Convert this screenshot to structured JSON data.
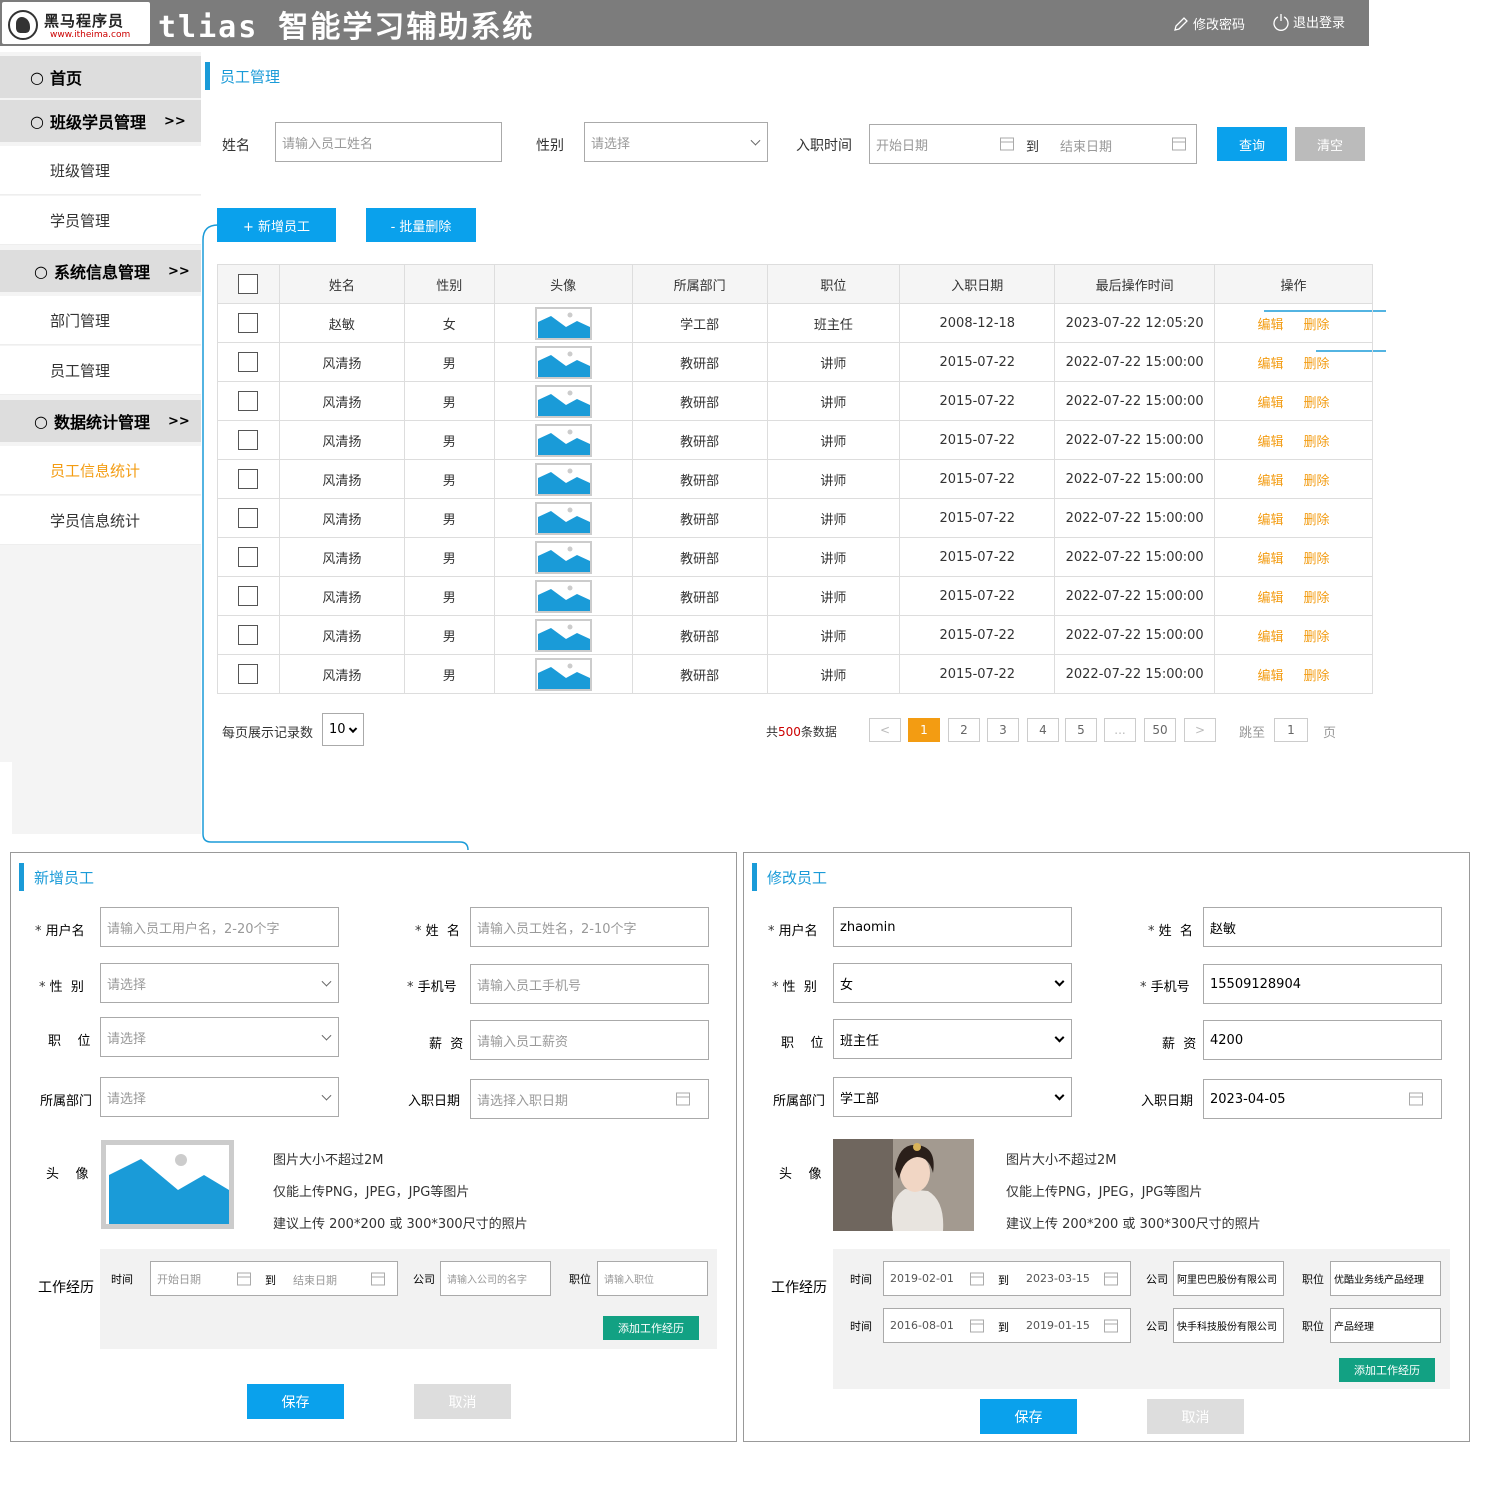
{
  "header": {
    "logo_text": "黑马程序员",
    "logo_sub": "www.itheima.com",
    "title": "tlias 智能学习辅助系统",
    "change_password": "修改密码",
    "logout": "退出登录"
  },
  "sidebar": {
    "home": "首页",
    "class_group": "班级学员管理",
    "class_mgmt": "班级管理",
    "student_mgmt": "学员管理",
    "sys_group": "系统信息管理",
    "dept_mgmt": "部门管理",
    "emp_mgmt": "员工管理",
    "stat_group": "数据统计管理",
    "emp_stat": "员工信息统计",
    "student_stat": "学员信息统计",
    "arrow": ">>"
  },
  "main": {
    "title": "员工管理",
    "search": {
      "name_label": "姓名",
      "name_placeholder": "请输入员工姓名",
      "gender_label": "性别",
      "gender_placeholder": "请选择",
      "date_label": "入职时间",
      "start_placeholder": "开始日期",
      "to": "到",
      "end_placeholder": "结束日期",
      "query": "查询",
      "clear": "清空"
    },
    "add_button": "+ 新增员工",
    "batch_delete": "- 批量删除",
    "columns": [
      "姓名",
      "性别",
      "头像",
      "所属部门",
      "职位",
      "入职日期",
      "最后操作时间",
      "操作"
    ],
    "edit": "编辑",
    "delete": "删除",
    "rows": [
      {
        "name": "赵敏",
        "gender": "女",
        "dept": "学工部",
        "job": "班主任",
        "entry": "2008-12-18",
        "updated": "2023-07-22 12:05:20"
      },
      {
        "name": "风清扬",
        "gender": "男",
        "dept": "教研部",
        "job": "讲师",
        "entry": "2015-07-22",
        "updated": "2022-07-22 15:00:00"
      },
      {
        "name": "风清扬",
        "gender": "男",
        "dept": "教研部",
        "job": "讲师",
        "entry": "2015-07-22",
        "updated": "2022-07-22 15:00:00"
      },
      {
        "name": "风清扬",
        "gender": "男",
        "dept": "教研部",
        "job": "讲师",
        "entry": "2015-07-22",
        "updated": "2022-07-22 15:00:00"
      },
      {
        "name": "风清扬",
        "gender": "男",
        "dept": "教研部",
        "job": "讲师",
        "entry": "2015-07-22",
        "updated": "2022-07-22 15:00:00"
      },
      {
        "name": "风清扬",
        "gender": "男",
        "dept": "教研部",
        "job": "讲师",
        "entry": "2015-07-22",
        "updated": "2022-07-22 15:00:00"
      },
      {
        "name": "风清扬",
        "gender": "男",
        "dept": "教研部",
        "job": "讲师",
        "entry": "2015-07-22",
        "updated": "2022-07-22 15:00:00"
      },
      {
        "name": "风清扬",
        "gender": "男",
        "dept": "教研部",
        "job": "讲师",
        "entry": "2015-07-22",
        "updated": "2022-07-22 15:00:00"
      },
      {
        "name": "风清扬",
        "gender": "男",
        "dept": "教研部",
        "job": "讲师",
        "entry": "2015-07-22",
        "updated": "2022-07-22 15:00:00"
      },
      {
        "name": "风清扬",
        "gender": "男",
        "dept": "教研部",
        "job": "讲师",
        "entry": "2015-07-22",
        "updated": "2022-07-22 15:00:00"
      }
    ],
    "page_size_label": "每页展示记录数",
    "page_size": "10",
    "total_prefix": "共",
    "total_count": "500",
    "total_suffix": "条数据",
    "pages": [
      "<",
      "1",
      "2",
      "3",
      "4",
      "5",
      "...",
      "50",
      ">"
    ],
    "current_page": "1",
    "jump_label": "跳至",
    "jump_value": "1",
    "page_unit": "页"
  },
  "add_dialog": {
    "title": "新增员工",
    "username_label": "用户名",
    "username_placeholder": "请输入员工用户名，2-20个字",
    "name_label": "姓  名",
    "name_placeholder": "请输入员工姓名，2-10个字",
    "gender_label": "性  别",
    "gender_placeholder": "请选择",
    "phone_label": "手机号",
    "phone_placeholder": "请输入员工手机号",
    "job_label": "职    位",
    "job_placeholder": "请选择",
    "salary_label": "薪  资",
    "salary_placeholder": "请输入员工薪资",
    "dept_label": "所属部门",
    "dept_placeholder": "请选择",
    "entry_label": "入职日期",
    "entry_placeholder": "请选择入职日期",
    "avatar_label": "头    像",
    "tip1": "图片大小不超过2M",
    "tip2": "仅能上传PNG，JPEG，JPG等图片",
    "tip3": "建议上传 200*200 或 300*300尺寸的照片",
    "exp_label": "工作经历",
    "time_label": "时间",
    "exp_start": "开始日期",
    "to": "到",
    "exp_end": "结束日期",
    "company_label": "公司",
    "company_placeholder": "请输入公司的名字",
    "position_label": "职位",
    "position_placeholder": "请输入职位",
    "add_exp": "添加工作经历",
    "save": "保存",
    "cancel": "取消"
  },
  "edit_dialog": {
    "title": "修改员工",
    "username_label": "用户名",
    "username": "zhaomin",
    "name_label": "姓  名",
    "name": "赵敏",
    "gender_label": "性  别",
    "gender": "女",
    "phone_label": "手机号",
    "phone": "15509128904",
    "job_label": "职    位",
    "job": "班主任",
    "salary_label": "薪  资",
    "salary": "4200",
    "dept_label": "所属部门",
    "dept": "学工部",
    "entry_label": "入职日期",
    "entry": "2023-04-05",
    "avatar_label": "头    像",
    "tip1": "图片大小不超过2M",
    "tip2": "仅能上传PNG，JPEG，JPG等图片",
    "tip3": "建议上传 200*200 或 300*300尺寸的照片",
    "exp_label": "工作经历",
    "time_label": "时间",
    "to": "到",
    "company_label": "公司",
    "position_label": "职位",
    "experiences": [
      {
        "start": "2019-02-01",
        "end": "2023-03-15",
        "company": "阿里巴巴股份有限公司",
        "position": "优酷业务线产品经理"
      },
      {
        "start": "2016-08-01",
        "end": "2019-01-15",
        "company": "快手科技股份有限公司",
        "position": "产品经理"
      }
    ],
    "add_exp": "添加工作经历",
    "save": "保存",
    "cancel": "取消"
  },
  "colors": {
    "accent": "#0aa1ec",
    "title_blue": "#1a9bd8",
    "orange": "#f39c12",
    "green": "#12a183",
    "header": "#7c7c7c"
  }
}
